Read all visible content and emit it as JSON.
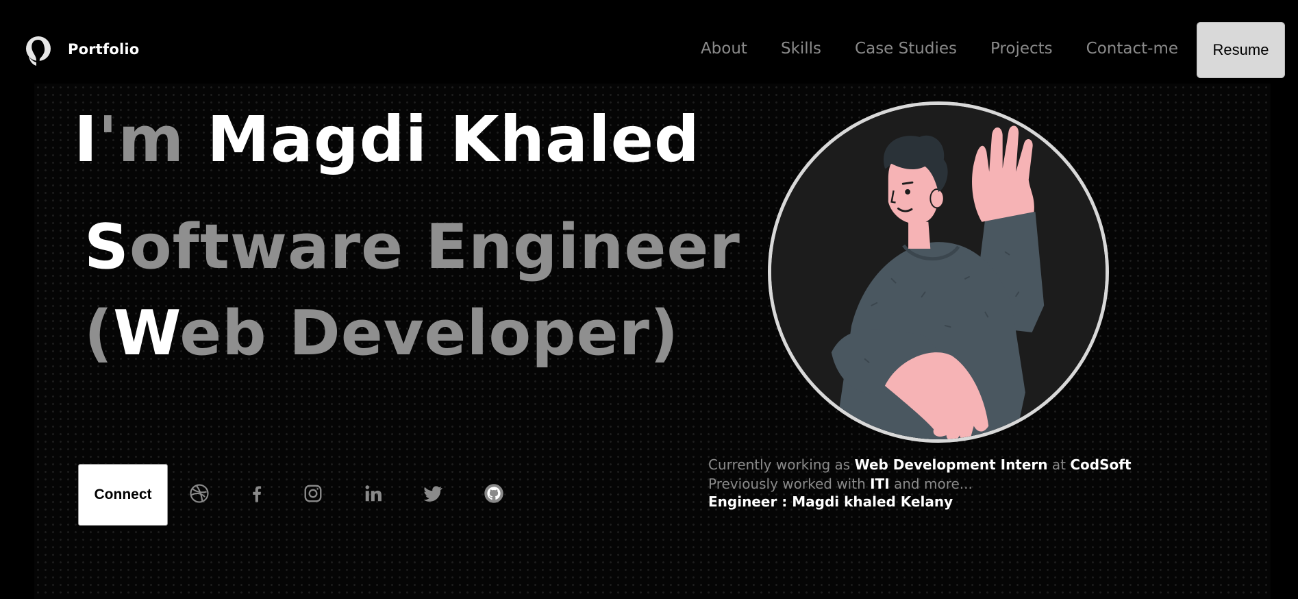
{
  "nav": {
    "brand": "Portfolio",
    "links": [
      "About",
      "Skills",
      "Case Studies",
      "Projects",
      "Contact-me"
    ],
    "resume_label": "Resume"
  },
  "hero": {
    "name_prefix_1": "I",
    "name_prefix_2": "'m",
    "name": " Magdi Khaled",
    "role_line1_first": "S",
    "role_line1_rest": "oftware Engineer",
    "role_line2_open": "(",
    "role_line2_w": "W",
    "role_line2_rest": "eb Developer)",
    "connect_label": "Connect"
  },
  "socials": [
    "dribbble-icon",
    "facebook-icon",
    "instagram-icon",
    "linkedin-icon",
    "twitter-icon",
    "github-icon"
  ],
  "info": {
    "text1": "Currently working as ",
    "role": "Web Development Intern",
    "text2": " at ",
    "company": "CodSoft",
    "text3": " Previously worked with ",
    "prev": "ITI",
    "text4": " and more...",
    "engineer_line": "Engineer : Magdi khaled Kelany"
  },
  "colors": {
    "background": "#000000",
    "text_primary": "#ffffff",
    "text_muted": "#8f8f8f",
    "resume_bg": "#d9d9d9",
    "avatar_border": "#d9d9d9"
  }
}
